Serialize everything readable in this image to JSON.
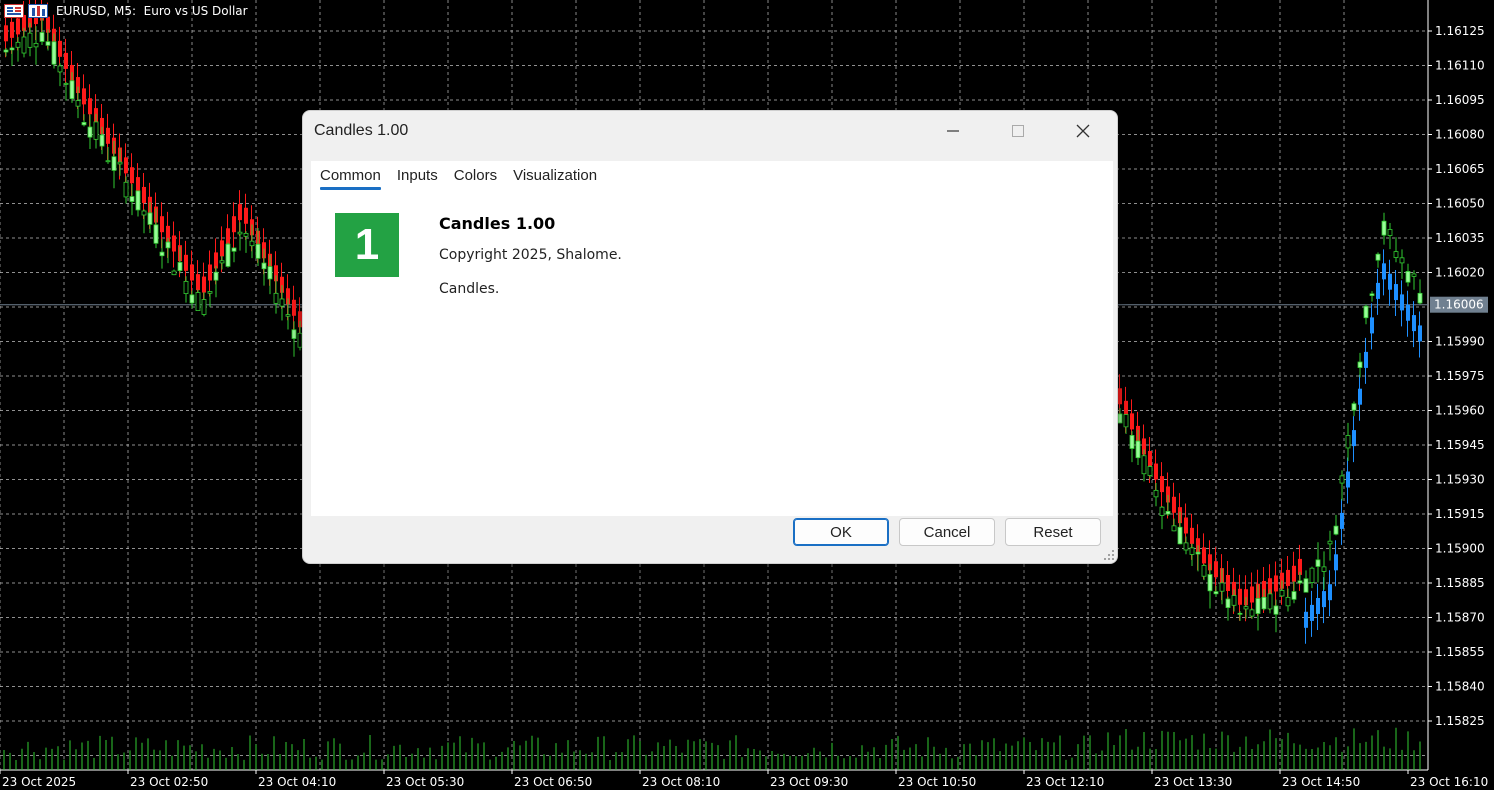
{
  "chart": {
    "title": "EURUSD, M5:  Euro vs US Dollar",
    "price_labels": [
      "1.16125",
      "1.16110",
      "1.16095",
      "1.16080",
      "1.16065",
      "1.16050",
      "1.16035",
      "1.16020",
      "1.15990",
      "1.15975",
      "1.15960",
      "1.15945",
      "1.15930",
      "1.15915",
      "1.15900",
      "1.15885",
      "1.15870",
      "1.15855",
      "1.15840",
      "1.15825"
    ],
    "current_price": "1.16006",
    "time_labels": [
      "23 Oct 2025",
      "23 Oct 02:50",
      "23 Oct 04:10",
      "23 Oct 05:30",
      "23 Oct 06:50",
      "23 Oct 08:10",
      "23 Oct 09:30",
      "23 Oct 10:50",
      "23 Oct 12:10",
      "23 Oct 13:30",
      "23 Oct 14:50",
      "23 Oct 16:10"
    ],
    "colors": {
      "bull": "#98fb98",
      "bear": "#000000",
      "wick": "#32cd32",
      "band_red": "#ff1a1a",
      "band_blue": "#1e90ff",
      "grid": "#c0c0c0",
      "volume": "#32cd32"
    },
    "icon": "chart-symbol-icon"
  },
  "dialog": {
    "title": "Candles 1.00",
    "tabs": [
      "Common",
      "Inputs",
      "Colors",
      "Visualization"
    ],
    "active_tab": "Common",
    "logo_text": "1",
    "name": "Candles 1.00",
    "copyright": "Copyright 2025, Shalome.",
    "description": "Candles.",
    "buttons": {
      "ok": "OK",
      "cancel": "Cancel",
      "reset": "Reset"
    },
    "window_icons": [
      "minimize-icon",
      "maximize-icon",
      "close-icon"
    ]
  }
}
